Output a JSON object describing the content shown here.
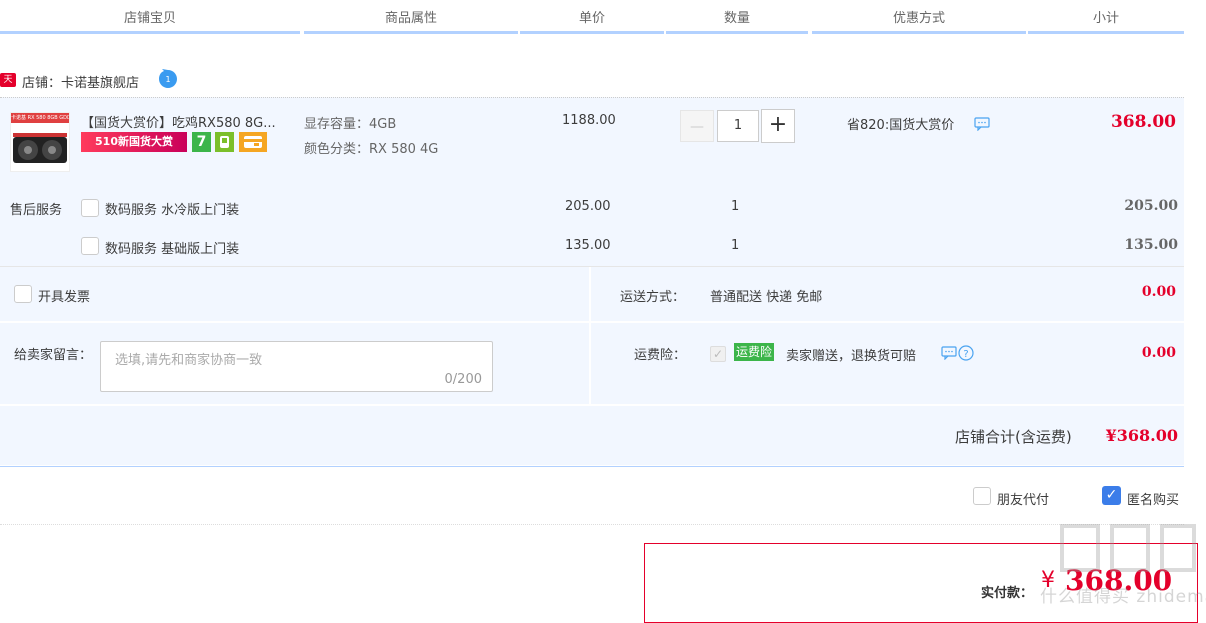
{
  "header": {
    "cols": [
      "店铺宝贝",
      "商品属性",
      "单价",
      "数量",
      "优惠方式",
      "小计"
    ]
  },
  "shop": {
    "badge": "天猫",
    "label": "店铺：卡诺基旗舰店",
    "chat_icon": "chat-bubble-icon"
  },
  "item": {
    "thumb_caption": "卡诺基 RX 580 8GB GDDR5",
    "title": "【国货大赏价】吃鸡RX580 8G...",
    "promo_banner": "510新国货大赏",
    "badge_seven": "7",
    "attr1_label": "显存容量：",
    "attr1_value": "4GB",
    "attr2_label": "颜色分类：",
    "attr2_value": "RX 580 4G",
    "price": "1188.00",
    "qty": "1",
    "minus": "—",
    "plus": "+",
    "discount": "省820:国货大赏价",
    "subtotal": "368.00"
  },
  "services": {
    "label": "售后服务",
    "rows": [
      {
        "name": "数码服务 水冷版上门装",
        "price": "205.00",
        "qty": "1",
        "subtotal": "205.00"
      },
      {
        "name": "数码服务 基础版上门装",
        "price": "135.00",
        "qty": "1",
        "subtotal": "135.00"
      }
    ]
  },
  "invoice": {
    "label": "开具发票"
  },
  "shipping": {
    "label": "运送方式：",
    "value": "普通配送 快递 免邮",
    "cost": "0.00"
  },
  "message": {
    "label": "给卖家留言：",
    "placeholder": "选填,请先和商家协商一致",
    "counter": "0/200"
  },
  "insurance": {
    "label": "运费险：",
    "tag": "运费险",
    "desc": "卖家赠送，退换货可赔",
    "cost": "0.00"
  },
  "total": {
    "label": "店铺合计(含运费)",
    "value": "¥368.00"
  },
  "options": {
    "friend_pay": "朋友代付",
    "anonymous": "匿名购买"
  },
  "pay": {
    "label": "实付款：",
    "currency": "¥",
    "amount": "368.00"
  },
  "watermark": "什么值得买 zhidemai.com",
  "colors": {
    "accent": "#b2d1ff",
    "price_red": "#e4002b",
    "row_bg": "#f2f7ff",
    "tag_green": "#3cb54a"
  }
}
